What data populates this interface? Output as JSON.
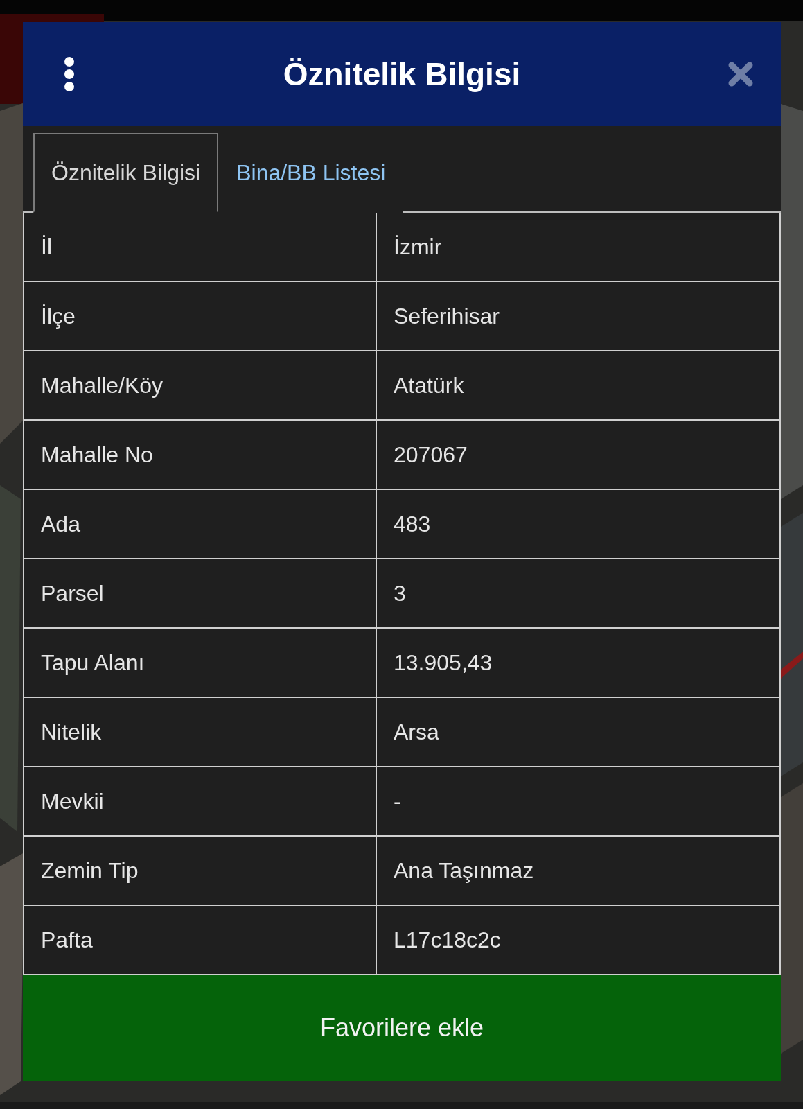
{
  "dialog": {
    "title": "Öznitelik Bilgisi"
  },
  "tabs": [
    {
      "label": "Öznitelik Bilgisi",
      "selected": true
    },
    {
      "label": "Bina/BB Listesi",
      "selected": false
    }
  ],
  "table": {
    "rows": [
      {
        "label": "İl",
        "value": "İzmir"
      },
      {
        "label": "İlçe",
        "value": "Seferihisar"
      },
      {
        "label": "Mahalle/Köy",
        "value": "Atatürk"
      },
      {
        "label": "Mahalle No",
        "value": "207067"
      },
      {
        "label": "Ada",
        "value": "483"
      },
      {
        "label": "Parsel",
        "value": "3"
      },
      {
        "label": "Tapu Alanı",
        "value": "13.905,43"
      },
      {
        "label": "Nitelik",
        "value": "Arsa"
      },
      {
        "label": "Mevkii",
        "value": "-"
      },
      {
        "label": "Zemin Tip",
        "value": "Ana Taşınmaz"
      },
      {
        "label": "Pafta",
        "value": "L17c18c2c"
      }
    ]
  },
  "button": {
    "label": "Favorilere ekle"
  }
}
